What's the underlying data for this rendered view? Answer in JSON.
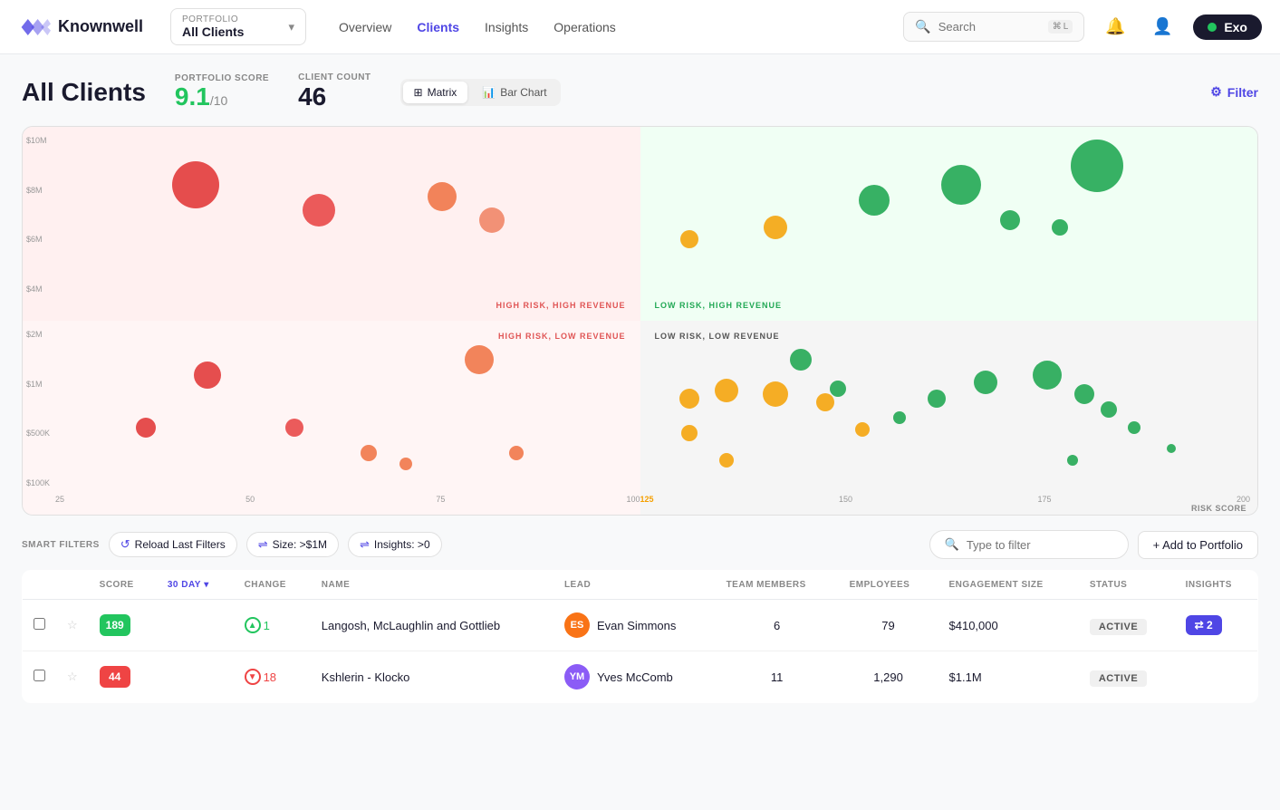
{
  "app": {
    "name": "Knownwell"
  },
  "navbar": {
    "portfolio_label": "PORTFOLIO",
    "portfolio_value": "All Clients",
    "nav_links": [
      {
        "label": "Overview",
        "active": false
      },
      {
        "label": "Clients",
        "active": true
      },
      {
        "label": "Insights",
        "active": false
      },
      {
        "label": "Operations",
        "active": false
      }
    ],
    "search_placeholder": "Search",
    "search_shortcut": "⌘L",
    "exo_label": "Exo"
  },
  "page": {
    "title": "All Clients",
    "portfolio_score_label": "PORTFOLIO SCORE",
    "portfolio_score": "9.1",
    "portfolio_score_denom": "/10",
    "client_count_label": "CLIENT COUNT",
    "client_count": "46",
    "filter_label": "Filter"
  },
  "view_toggle": {
    "matrix_label": "Matrix",
    "bar_chart_label": "Bar Chart"
  },
  "smart_filters": {
    "label": "SMART FILTERS",
    "reload_label": "Reload Last Filters",
    "size_label": "Size: >$1M",
    "insights_label": "Insights: >0",
    "filter_placeholder": "Type to filter",
    "add_portfolio_label": "+ Add to Portfolio"
  },
  "table": {
    "columns": [
      "",
      "",
      "SCORE",
      "30 DAY",
      "CHANGE",
      "NAME",
      "LEAD",
      "TEAM MEMBERS",
      "EMPLOYEES",
      "ENGAGEMENT SIZE",
      "STATUS",
      "INSIGHTS"
    ],
    "day_label": "30 DAY",
    "rows": [
      {
        "score": "189",
        "score_color": "green",
        "change_dir": "up",
        "change_val": "1",
        "name": "Langosh, McLaughlin and Gottlieb",
        "lead": "Evan Simmons",
        "lead_initials": "ES",
        "lead_color": "#f97316",
        "team_members": "6",
        "employees": "79",
        "engagement_size": "$410,000",
        "status": "ACTIVE",
        "insights": "2"
      },
      {
        "score": "44",
        "score_color": "red",
        "change_dir": "down",
        "change_val": "18",
        "name": "Kshlerin - Klocko",
        "lead": "Yves McComb",
        "lead_initials": "YM",
        "lead_color": "#8b5cf6",
        "team_members": "11",
        "employees": "1,290",
        "engagement_size": "$1.1M",
        "status": "ACTIVE",
        "insights": ""
      }
    ]
  },
  "quadrants": {
    "high_risk_high_revenue": "HIGH RISK, HIGH REVENUE",
    "low_risk_high_revenue": "LOW RISK, HIGH REVENUE",
    "high_risk_low_revenue": "HIGH RISK, LOW REVENUE",
    "low_risk_low_revenue": "LOW RISK, LOW REVENUE",
    "risk_score_label": "RISK SCORE"
  },
  "y_axis": [
    "$10M",
    "$8M",
    "$6M",
    "$4M",
    "$2M",
    "$1M",
    "$500K",
    "$100K"
  ],
  "x_axis_bottom": [
    "25",
    "50",
    "75",
    "100",
    "125",
    "150",
    "175",
    "200"
  ]
}
